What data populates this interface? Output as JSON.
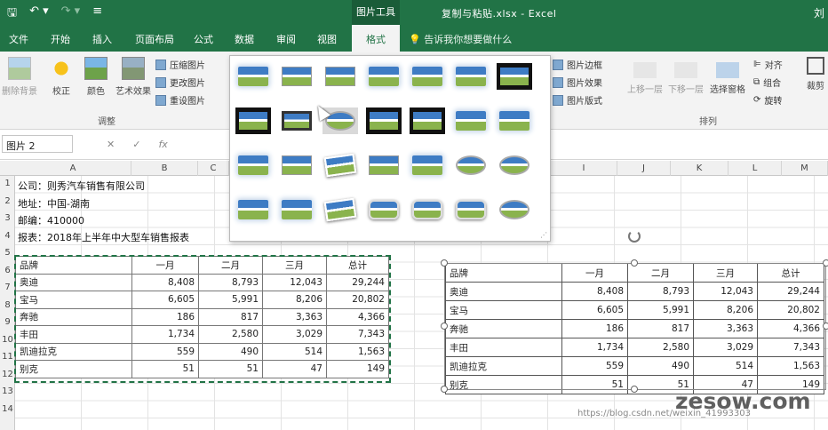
{
  "titlebar": {
    "context_tab": "图片工具",
    "doc_title": "复制与粘贴.xlsx  -  Excel",
    "user": "刘",
    "qat": [
      "save-icon",
      "undo-icon",
      "redo-icon",
      "customize-icon"
    ]
  },
  "tabs": [
    "文件",
    "开始",
    "插入",
    "页面布局",
    "公式",
    "数据",
    "审阅",
    "视图",
    "格式"
  ],
  "active_tab": "格式",
  "tell_me": "告诉我你想要做什么",
  "ribbon": {
    "adjust": {
      "label": "调整",
      "remove_bg": "删除背景",
      "correct": "校正",
      "color": "颜色",
      "artistic": "艺术效果",
      "compress": "压缩图片",
      "change": "更改图片",
      "reset": "重设图片"
    },
    "picture_styles": {
      "border": "图片边框",
      "effects": "图片效果",
      "layout": "图片版式"
    },
    "arrange": {
      "label": "排列",
      "forward": "上移一层",
      "backward": "下移一层",
      "selection_pane": "选择窗格",
      "align": "对齐",
      "group": "组合",
      "rotate": "旋转"
    },
    "size": {
      "crop": "裁剪"
    }
  },
  "namebox": "图片 2",
  "columns": [
    "A",
    "B",
    "C",
    "",
    "",
    "",
    "",
    "",
    "",
    "I",
    "J",
    "K",
    "L",
    "M"
  ],
  "rows": [
    "1",
    "2",
    "3",
    "4",
    "5",
    "6",
    "7",
    "8",
    "9",
    "10",
    "11",
    "12",
    "13",
    "14"
  ],
  "info_lines": [
    "公司：则秀汽车销售有限公司",
    "地址：中国-湖南",
    "邮编：410000",
    "报表：2018年上半年中大型车销售报表"
  ],
  "table": {
    "header": [
      "品牌",
      "一月",
      "二月",
      "三月",
      "总计"
    ],
    "rows": [
      [
        "奥迪",
        "8,408",
        "8,793",
        "12,043",
        "29,244"
      ],
      [
        "宝马",
        "6,605",
        "5,991",
        "8,206",
        "20,802"
      ],
      [
        "奔驰",
        "186",
        "817",
        "3,363",
        "4,366"
      ],
      [
        "丰田",
        "1,734",
        "2,580",
        "3,029",
        "7,343"
      ],
      [
        "凯迪拉克",
        "559",
        "490",
        "514",
        "1,563"
      ],
      [
        "别克",
        "51",
        "51",
        "47",
        "149"
      ]
    ]
  },
  "watermark": "zesow.com",
  "watermark_url": "https://blog.csdn.net/weixin_41993303"
}
